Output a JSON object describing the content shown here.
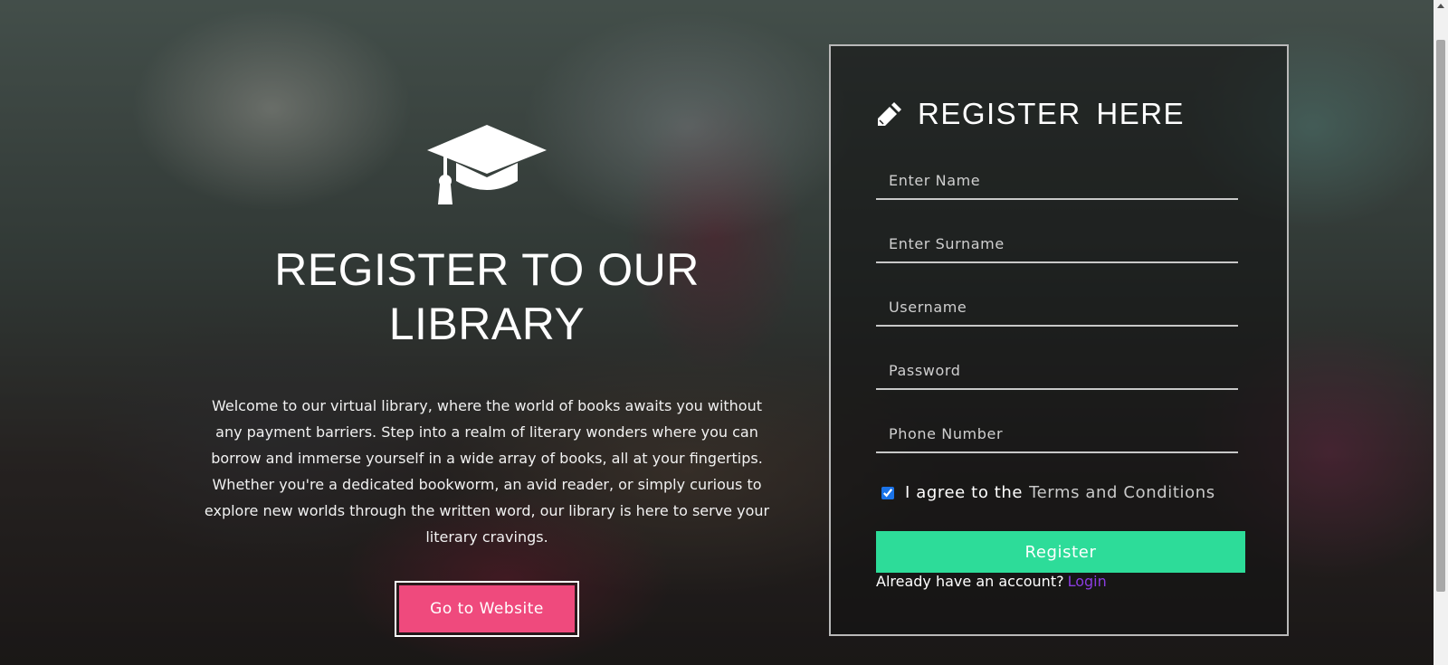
{
  "hero": {
    "icon": "graduation-cap-icon",
    "title": "REGISTER TO OUR LIBRARY",
    "description": "Welcome to our virtual library, where the world of books awaits you without any payment barriers. Step into a realm of literary wonders where you can borrow and immerse yourself in a wide array of books, all at your fingertips. Whether you're a dedicated bookworm, an avid reader, or simply curious to explore new worlds through the written word, our library is here to serve your literary cravings.",
    "button_label": "Go to Website"
  },
  "form": {
    "icon": "pencil-icon",
    "title": "REGISTER HERE",
    "fields": {
      "name": {
        "placeholder": "Enter Name",
        "value": ""
      },
      "surname": {
        "placeholder": "Enter Surname",
        "value": ""
      },
      "username": {
        "placeholder": "Username",
        "value": ""
      },
      "password": {
        "placeholder": "Password",
        "value": ""
      },
      "phone": {
        "placeholder": "Phone Number",
        "value": ""
      }
    },
    "agree_text": "I agree to the",
    "terms_link": "Terms and Conditions",
    "agree_checked": true,
    "register_label": "Register",
    "login_prompt": "Already have an account?",
    "login_link": "Login"
  },
  "colors": {
    "accent_pink": "#ef4a7d",
    "accent_green": "#2ddc99",
    "link_purple": "#8a3ce0"
  }
}
